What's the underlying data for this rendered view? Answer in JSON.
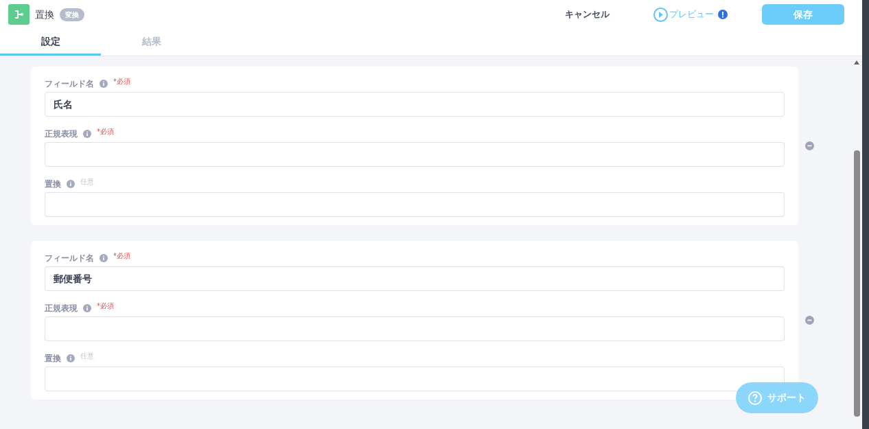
{
  "header": {
    "title": "置換",
    "badge": "変換",
    "cancel": "キャンセル",
    "preview": "プレビュー",
    "save": "保存"
  },
  "tabs": [
    {
      "label": "設定",
      "selected": true
    },
    {
      "label": "結果",
      "selected": false
    }
  ],
  "cards": [
    {
      "fields": [
        {
          "label": "フィールド名",
          "tag": {
            "text": "*必須",
            "kind": "required"
          },
          "value": "氏名"
        },
        {
          "label": "正規表現",
          "tag": {
            "text": "*必須",
            "kind": "required"
          }
        },
        {
          "label": "置換",
          "tag": {
            "text": "任意",
            "kind": "optional"
          }
        }
      ]
    },
    {
      "fields": [
        {
          "label": "フィールド名",
          "tag": {
            "text": "*必須",
            "kind": "required"
          },
          "value": "郵便番号"
        },
        {
          "label": "正規表現",
          "tag": {
            "text": "*必須",
            "kind": "required"
          }
        },
        {
          "label": "置換",
          "tag": {
            "text": "任意",
            "kind": "optional"
          }
        }
      ]
    }
  ],
  "support": "サポート"
}
